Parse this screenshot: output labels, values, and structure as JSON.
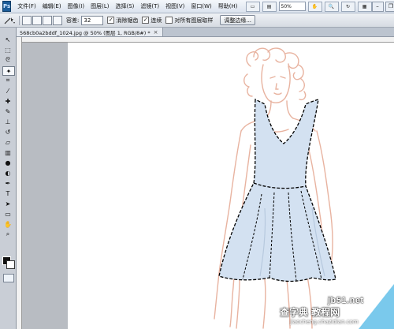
{
  "app": {
    "logo": "Ps"
  },
  "menu": {
    "items": [
      "文件(F)",
      "编辑(E)",
      "图像(I)",
      "图层(L)",
      "选择(S)",
      "滤镜(T)",
      "视图(V)",
      "窗口(W)",
      "帮助(H)"
    ],
    "zoom": "50%"
  },
  "options": {
    "tolerance_label": "容差:",
    "tolerance_value": "32",
    "antialias_label": "消除锯齿",
    "contiguous_label": "连续",
    "sample_all_label": "对所有图层取样",
    "refine_edge_label": "调整边缘..."
  },
  "document": {
    "tab_title": "568cb0a2bddf_1024.jpg @ 50% (图层 1, RGB/8#) *"
  },
  "toolbox": {
    "tools": [
      "move-tool-icon",
      "marquee-tool-icon",
      "lasso-tool-icon",
      "magic-wand-tool-icon",
      "crop-tool-icon",
      "eyedropper-tool-icon",
      "healing-brush-icon",
      "brush-tool-icon",
      "clone-stamp-icon",
      "history-brush-icon",
      "eraser-tool-icon",
      "gradient-tool-icon",
      "blur-tool-icon",
      "dodge-tool-icon",
      "pen-tool-icon",
      "type-tool-icon",
      "path-selection-icon",
      "shape-tool-icon",
      "hand-tool-icon",
      "zoom-tool-icon"
    ],
    "active_tool": "magic-wand-tool-icon"
  },
  "watermark": {
    "site": "jb51.net",
    "cn": "查字典 教程网",
    "url": "jiaocheng.chazidian.com"
  },
  "colors": {
    "dress_fill": "#d3e1f1",
    "sketch_stroke": "#e8b3a0",
    "marching_ants": "#000000"
  }
}
